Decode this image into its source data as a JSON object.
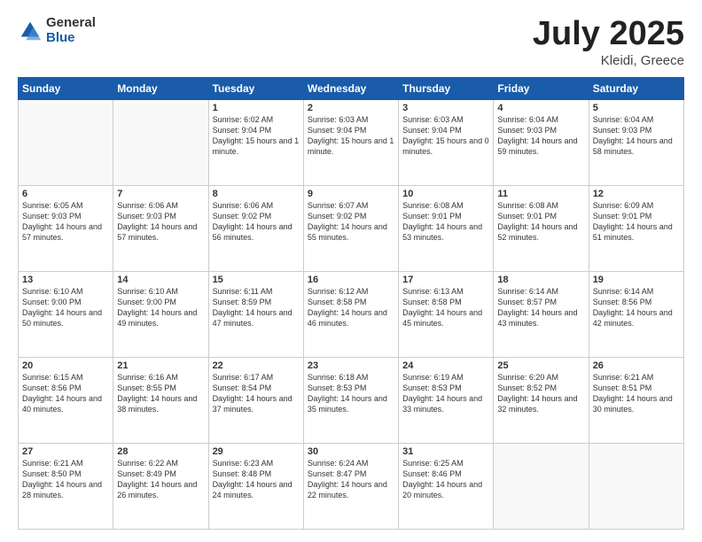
{
  "logo": {
    "general": "General",
    "blue": "Blue"
  },
  "header": {
    "title": "July 2025",
    "subtitle": "Kleidi, Greece"
  },
  "days_of_week": [
    "Sunday",
    "Monday",
    "Tuesday",
    "Wednesday",
    "Thursday",
    "Friday",
    "Saturday"
  ],
  "weeks": [
    [
      {
        "day": "",
        "info": ""
      },
      {
        "day": "",
        "info": ""
      },
      {
        "day": "1",
        "info": "Sunrise: 6:02 AM\nSunset: 9:04 PM\nDaylight: 15 hours and 1 minute."
      },
      {
        "day": "2",
        "info": "Sunrise: 6:03 AM\nSunset: 9:04 PM\nDaylight: 15 hours and 1 minute."
      },
      {
        "day": "3",
        "info": "Sunrise: 6:03 AM\nSunset: 9:04 PM\nDaylight: 15 hours and 0 minutes."
      },
      {
        "day": "4",
        "info": "Sunrise: 6:04 AM\nSunset: 9:03 PM\nDaylight: 14 hours and 59 minutes."
      },
      {
        "day": "5",
        "info": "Sunrise: 6:04 AM\nSunset: 9:03 PM\nDaylight: 14 hours and 58 minutes."
      }
    ],
    [
      {
        "day": "6",
        "info": "Sunrise: 6:05 AM\nSunset: 9:03 PM\nDaylight: 14 hours and 57 minutes."
      },
      {
        "day": "7",
        "info": "Sunrise: 6:06 AM\nSunset: 9:03 PM\nDaylight: 14 hours and 57 minutes."
      },
      {
        "day": "8",
        "info": "Sunrise: 6:06 AM\nSunset: 9:02 PM\nDaylight: 14 hours and 56 minutes."
      },
      {
        "day": "9",
        "info": "Sunrise: 6:07 AM\nSunset: 9:02 PM\nDaylight: 14 hours and 55 minutes."
      },
      {
        "day": "10",
        "info": "Sunrise: 6:08 AM\nSunset: 9:01 PM\nDaylight: 14 hours and 53 minutes."
      },
      {
        "day": "11",
        "info": "Sunrise: 6:08 AM\nSunset: 9:01 PM\nDaylight: 14 hours and 52 minutes."
      },
      {
        "day": "12",
        "info": "Sunrise: 6:09 AM\nSunset: 9:01 PM\nDaylight: 14 hours and 51 minutes."
      }
    ],
    [
      {
        "day": "13",
        "info": "Sunrise: 6:10 AM\nSunset: 9:00 PM\nDaylight: 14 hours and 50 minutes."
      },
      {
        "day": "14",
        "info": "Sunrise: 6:10 AM\nSunset: 9:00 PM\nDaylight: 14 hours and 49 minutes."
      },
      {
        "day": "15",
        "info": "Sunrise: 6:11 AM\nSunset: 8:59 PM\nDaylight: 14 hours and 47 minutes."
      },
      {
        "day": "16",
        "info": "Sunrise: 6:12 AM\nSunset: 8:58 PM\nDaylight: 14 hours and 46 minutes."
      },
      {
        "day": "17",
        "info": "Sunrise: 6:13 AM\nSunset: 8:58 PM\nDaylight: 14 hours and 45 minutes."
      },
      {
        "day": "18",
        "info": "Sunrise: 6:14 AM\nSunset: 8:57 PM\nDaylight: 14 hours and 43 minutes."
      },
      {
        "day": "19",
        "info": "Sunrise: 6:14 AM\nSunset: 8:56 PM\nDaylight: 14 hours and 42 minutes."
      }
    ],
    [
      {
        "day": "20",
        "info": "Sunrise: 6:15 AM\nSunset: 8:56 PM\nDaylight: 14 hours and 40 minutes."
      },
      {
        "day": "21",
        "info": "Sunrise: 6:16 AM\nSunset: 8:55 PM\nDaylight: 14 hours and 38 minutes."
      },
      {
        "day": "22",
        "info": "Sunrise: 6:17 AM\nSunset: 8:54 PM\nDaylight: 14 hours and 37 minutes."
      },
      {
        "day": "23",
        "info": "Sunrise: 6:18 AM\nSunset: 8:53 PM\nDaylight: 14 hours and 35 minutes."
      },
      {
        "day": "24",
        "info": "Sunrise: 6:19 AM\nSunset: 8:53 PM\nDaylight: 14 hours and 33 minutes."
      },
      {
        "day": "25",
        "info": "Sunrise: 6:20 AM\nSunset: 8:52 PM\nDaylight: 14 hours and 32 minutes."
      },
      {
        "day": "26",
        "info": "Sunrise: 6:21 AM\nSunset: 8:51 PM\nDaylight: 14 hours and 30 minutes."
      }
    ],
    [
      {
        "day": "27",
        "info": "Sunrise: 6:21 AM\nSunset: 8:50 PM\nDaylight: 14 hours and 28 minutes."
      },
      {
        "day": "28",
        "info": "Sunrise: 6:22 AM\nSunset: 8:49 PM\nDaylight: 14 hours and 26 minutes."
      },
      {
        "day": "29",
        "info": "Sunrise: 6:23 AM\nSunset: 8:48 PM\nDaylight: 14 hours and 24 minutes."
      },
      {
        "day": "30",
        "info": "Sunrise: 6:24 AM\nSunset: 8:47 PM\nDaylight: 14 hours and 22 minutes."
      },
      {
        "day": "31",
        "info": "Sunrise: 6:25 AM\nSunset: 8:46 PM\nDaylight: 14 hours and 20 minutes."
      },
      {
        "day": "",
        "info": ""
      },
      {
        "day": "",
        "info": ""
      }
    ]
  ]
}
